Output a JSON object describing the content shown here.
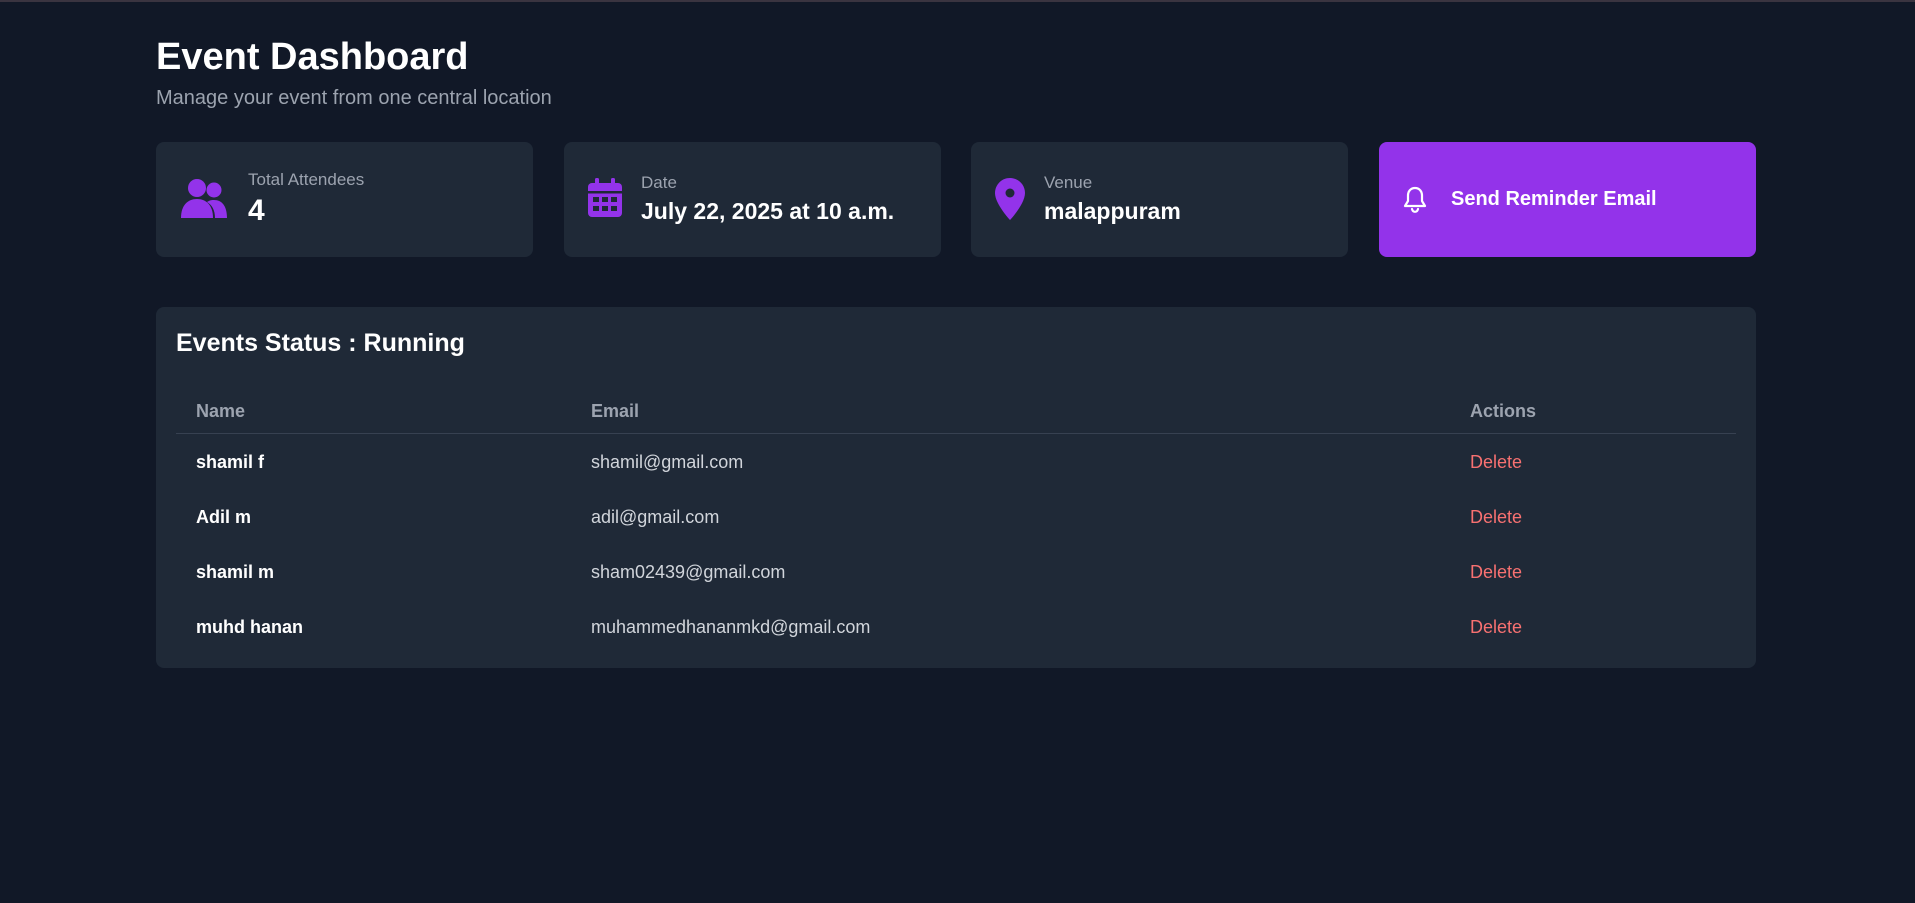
{
  "header": {
    "title": "Event Dashboard",
    "subtitle": "Manage your event from one central location"
  },
  "stats": {
    "attendees": {
      "label": "Total Attendees",
      "value": "4",
      "icon": "users-icon"
    },
    "date": {
      "label": "Date",
      "value": "July 22, 2025 at 10 a.m.",
      "icon": "calendar-icon"
    },
    "venue": {
      "label": "Venue",
      "value": "malappuram",
      "icon": "map-pin-icon"
    }
  },
  "reminder_button": {
    "label": "Send Reminder Email",
    "icon": "bell-icon"
  },
  "status_panel": {
    "title": "Events Status : Running",
    "columns": {
      "name": "Name",
      "email": "Email",
      "actions": "Actions"
    },
    "rows": [
      {
        "name": "shamil f",
        "email": "shamil@gmail.com",
        "action": "Delete"
      },
      {
        "name": "Adil m",
        "email": "adil@gmail.com",
        "action": "Delete"
      },
      {
        "name": "shamil m",
        "email": "sham02439@gmail.com",
        "action": "Delete"
      },
      {
        "name": "muhd hanan",
        "email": "muhammedhananmkd@gmail.com",
        "action": "Delete"
      }
    ]
  },
  "colors": {
    "background": "#111827",
    "card": "#1f2937",
    "accent": "#9333ea",
    "danger": "#f87171",
    "muted": "#9ca3af"
  }
}
